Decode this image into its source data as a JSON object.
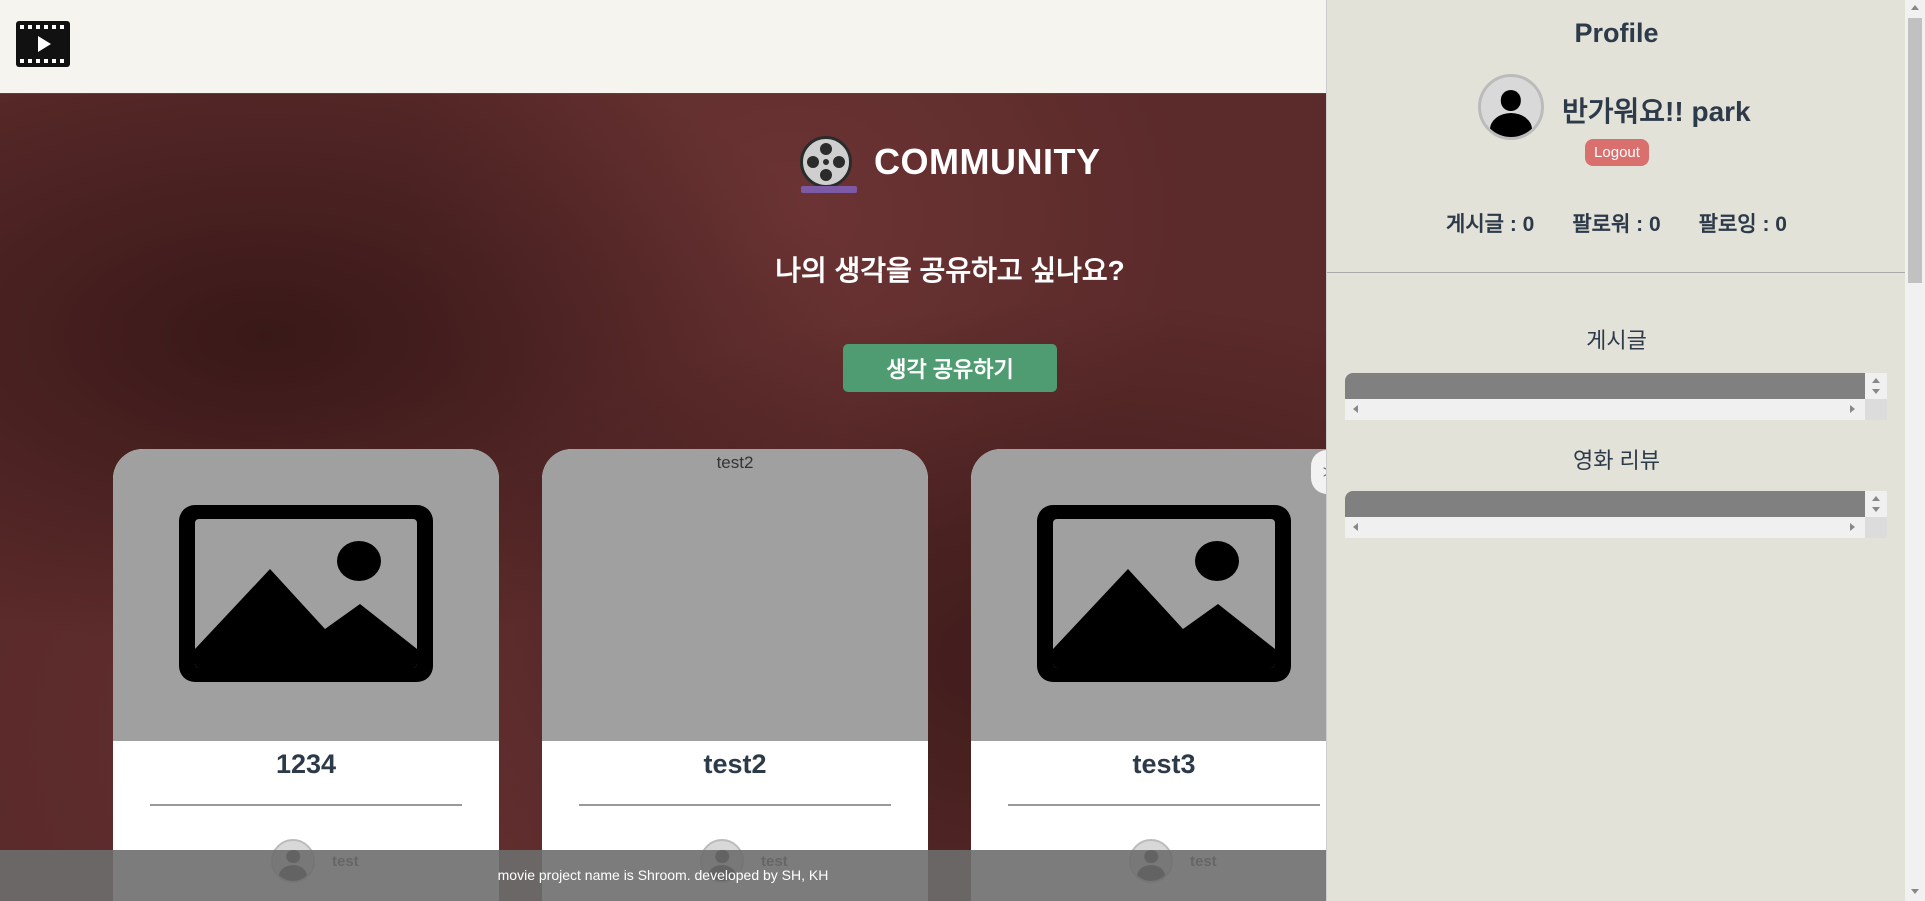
{
  "header": {
    "logo_icon": "film-play-icon"
  },
  "community": {
    "icon": "film-reel-icon",
    "title": "COMMUNITY",
    "question": "나의 생각을 공유하고 싶나요?",
    "share_button": "생각 공유하기",
    "next_arrow": ">",
    "cards": [
      {
        "title": "1234",
        "image": "image-placeholder-icon",
        "author": "test"
      },
      {
        "title": "test2",
        "image_alt": "test2",
        "author": "test"
      },
      {
        "title": "test3",
        "image": "image-placeholder-icon",
        "author": "test"
      }
    ]
  },
  "footer": {
    "text": "movie project name is Shroom. developed by SH, KH"
  },
  "profile": {
    "title": "Profile",
    "greeting": "반가워요!! park",
    "logout": "Logout",
    "stats": {
      "posts": "게시글 : 0",
      "followers": "팔로워 : 0",
      "following": "팔로잉 : 0"
    },
    "sections": {
      "posts": "게시글",
      "reviews": "영화 리뷰"
    }
  },
  "colors": {
    "accent_green": "#4f9c72",
    "logout_red": "#d9706e",
    "panel_bg": "#e3e2d9",
    "text_dark": "#2d3a4a"
  }
}
